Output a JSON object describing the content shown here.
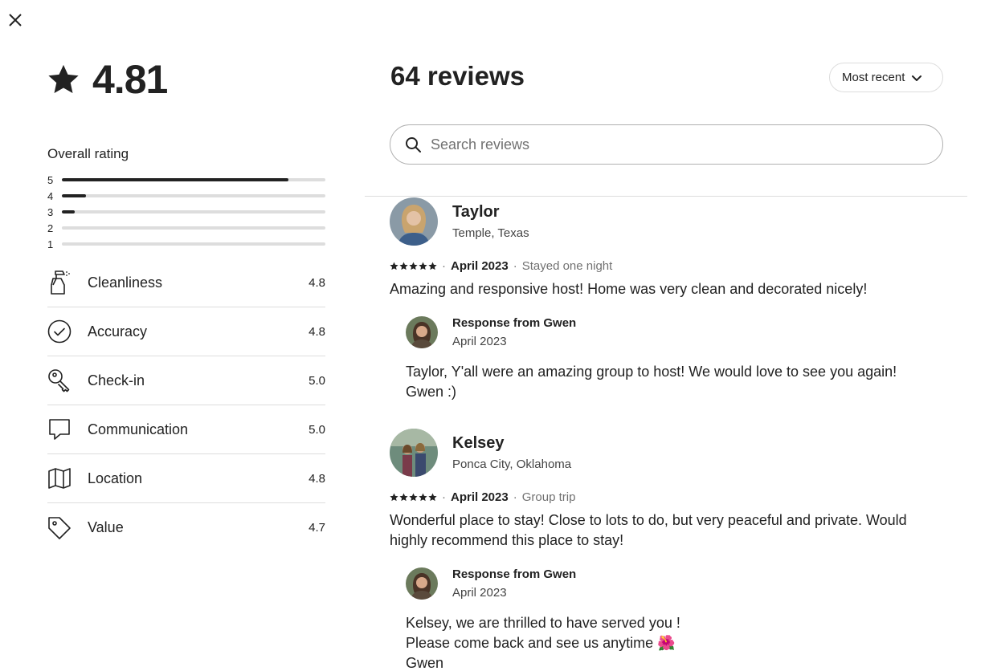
{
  "rating": {
    "score": "4.81",
    "overall_label": "Overall rating",
    "distribution": [
      {
        "stars": "5",
        "fraction": 0.86
      },
      {
        "stars": "4",
        "fraction": 0.09
      },
      {
        "stars": "3",
        "fraction": 0.05
      },
      {
        "stars": "2",
        "fraction": 0.0
      },
      {
        "stars": "1",
        "fraction": 0.0
      }
    ],
    "categories": [
      {
        "label": "Cleanliness",
        "value": "4.8",
        "icon": "spray-bottle-icon"
      },
      {
        "label": "Accuracy",
        "value": "4.8",
        "icon": "check-circle-icon"
      },
      {
        "label": "Check-in",
        "value": "5.0",
        "icon": "key-icon"
      },
      {
        "label": "Communication",
        "value": "5.0",
        "icon": "chat-bubble-icon"
      },
      {
        "label": "Location",
        "value": "4.8",
        "icon": "map-icon"
      },
      {
        "label": "Value",
        "value": "4.7",
        "icon": "tag-icon"
      }
    ]
  },
  "reviews_header": {
    "title": "64 reviews",
    "sort_label": "Most recent",
    "search_placeholder": "Search reviews"
  },
  "reviews": [
    {
      "name": "Taylor",
      "location": "Temple, Texas",
      "rating": 5,
      "date": "April 2023",
      "stay": "Stayed one night",
      "text": "Amazing and responsive host! Home was very clean and decorated nicely!",
      "response": {
        "title": "Response from Gwen",
        "date": "April 2023",
        "text": "Taylor, Y'all were an amazing group to host! We would love to see you again!\nGwen :)"
      }
    },
    {
      "name": "Kelsey",
      "location": "Ponca City, Oklahoma",
      "rating": 5,
      "date": "April 2023",
      "stay": "Group trip",
      "text": "Wonderful place to stay! Close to lots to do, but very peaceful and private. Would highly recommend this place to stay!",
      "response": {
        "title": "Response from Gwen",
        "date": "April 2023",
        "text": "Kelsey, we are thrilled to have served you !\nPlease come back and see us anytime 🌺\nGwen"
      }
    }
  ]
}
